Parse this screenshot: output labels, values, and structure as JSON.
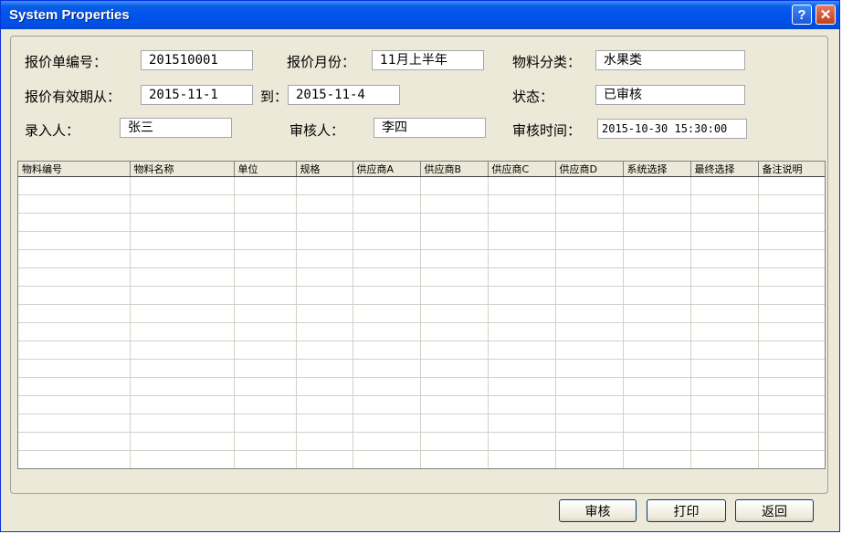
{
  "window": {
    "title": "System Properties",
    "help_label": "?",
    "close_label": "✕"
  },
  "form": {
    "quote_no": {
      "label": "报价单编号：",
      "value": "201510001"
    },
    "quote_month": {
      "label": "报价月份：",
      "value": "11月上半年"
    },
    "category": {
      "label": "物料分类：",
      "value": "水果类"
    },
    "valid_from": {
      "label": "报价有效期从：",
      "value": "2015-11-1"
    },
    "valid_to": {
      "label": "到：",
      "value": "2015-11-4"
    },
    "status": {
      "label": "状态：",
      "value": "已审核"
    },
    "entered_by": {
      "label": "录入人：",
      "value": "张三"
    },
    "reviewer": {
      "label": "审核人：",
      "value": "李四"
    },
    "review_time": {
      "label": "审核时间：",
      "value": "2015-10-30 15:30:00"
    }
  },
  "grid": {
    "columns": [
      "物料编号",
      "物料名称",
      "单位",
      "规格",
      "供应商A",
      "供应商B",
      "供应商C",
      "供应商D",
      "系统选择",
      "最终选择",
      "备注说明"
    ]
  },
  "buttons": {
    "approve": "审核",
    "print": "打印",
    "back": "返回"
  },
  "colors": {
    "titlebar": "#0053ee",
    "window_bg": "#ece9d8",
    "close_button": "#c13e1e"
  }
}
